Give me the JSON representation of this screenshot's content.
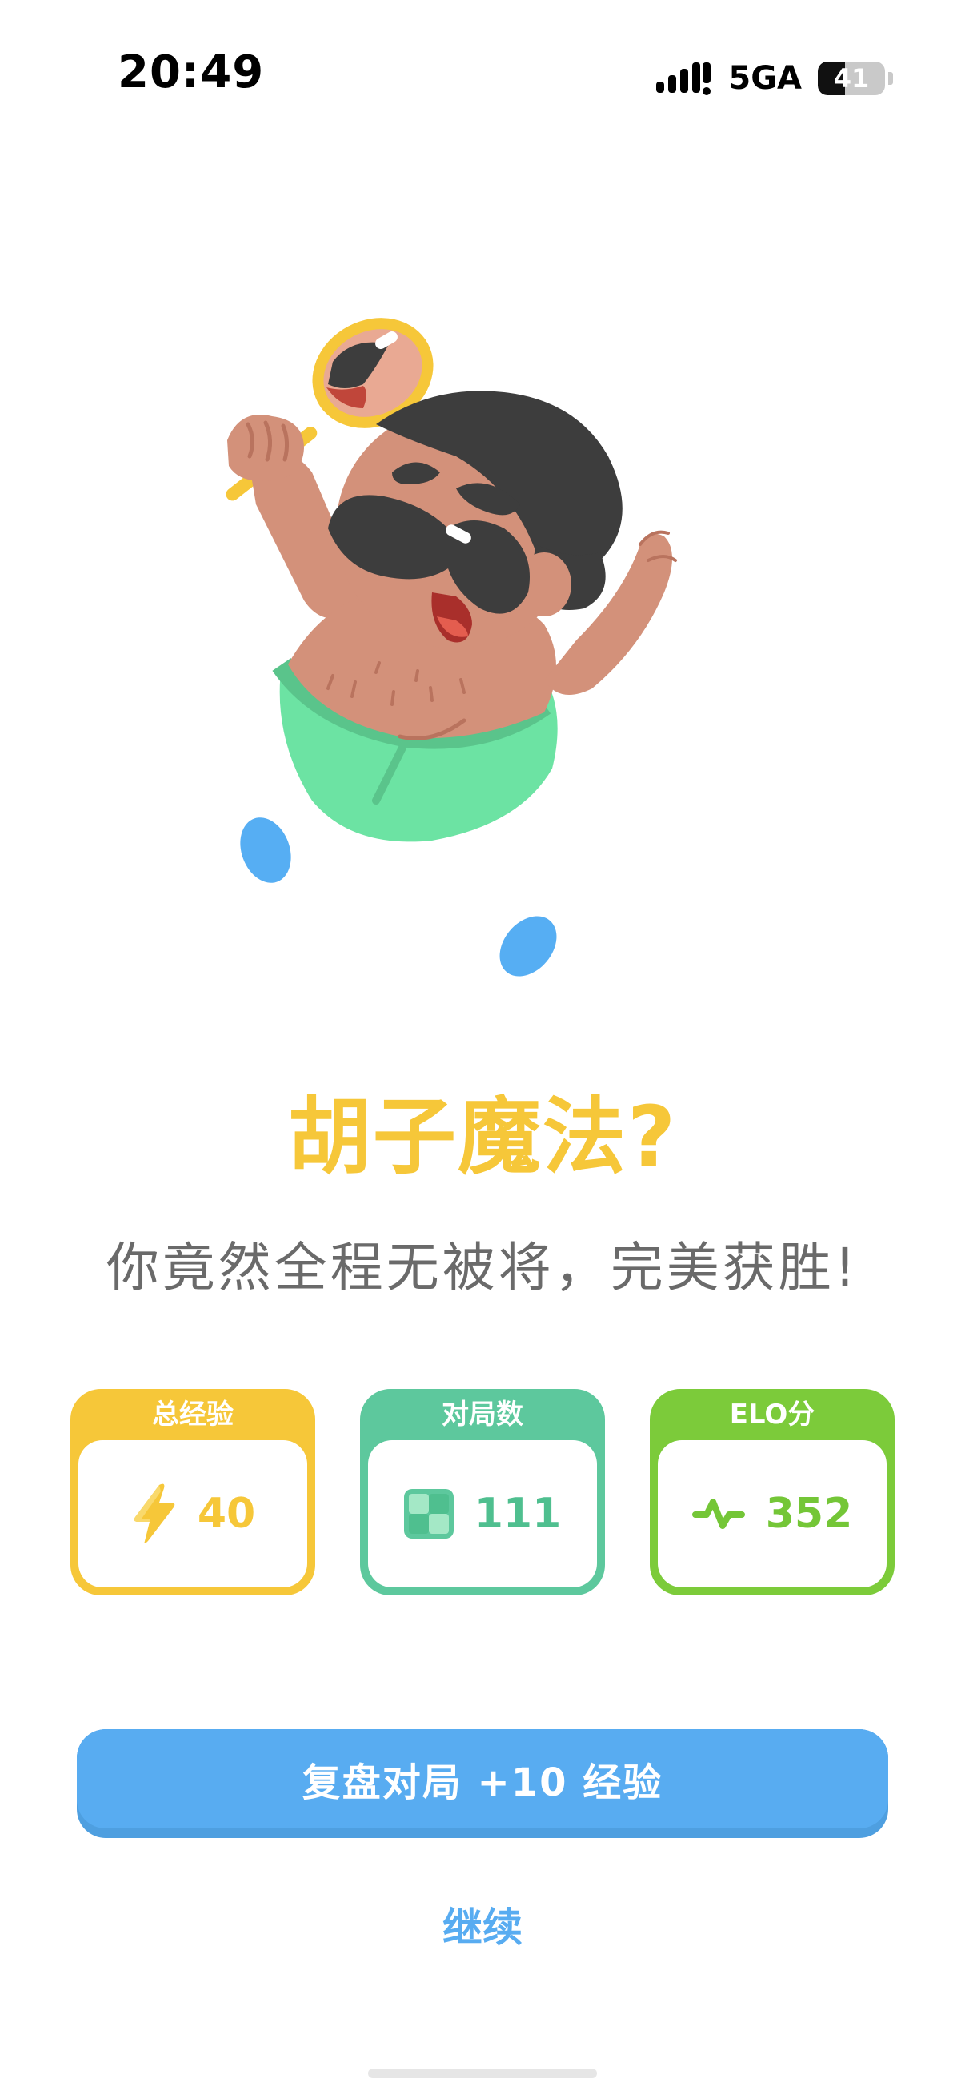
{
  "status_bar": {
    "time": "20:49",
    "network": "5GA",
    "battery_level": "41",
    "battery_percent": 41
  },
  "illustration": {
    "icon": "mustache-character-with-mirror-illustration"
  },
  "result": {
    "title": "胡子魔法?",
    "subtitle": "你竟然全程无被将，完美获胜!"
  },
  "stats": [
    {
      "label": "总经验",
      "value": "40",
      "icon": "lightning-icon",
      "color": "#f6c739"
    },
    {
      "label": "对局数",
      "value": "111",
      "icon": "chessboard-icon",
      "color": "#5dc89d"
    },
    {
      "label": "ELO分",
      "value": "352",
      "icon": "pulse-icon",
      "color": "#7ccb3a"
    }
  ],
  "actions": {
    "review_label": "复盘对局 +10 经验",
    "continue_label": "继续"
  },
  "colors": {
    "accent_yellow": "#f6c739",
    "accent_blue": "#58acf1",
    "text_gray": "#6a6a6a"
  }
}
